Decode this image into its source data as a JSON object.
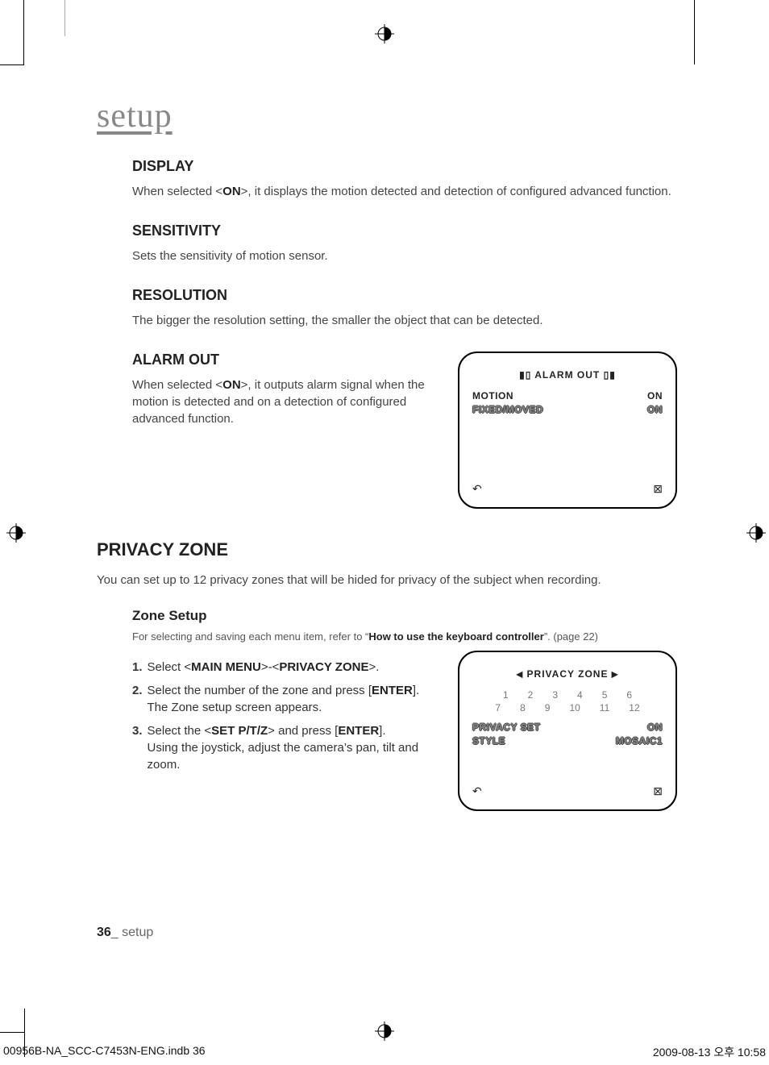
{
  "chapter_title": "setup",
  "sections": {
    "display": {
      "heading": "DISPLAY",
      "body_pre": "When selected <",
      "body_bold": "ON",
      "body_post": ">, it displays the motion detected and detection of configured advanced function."
    },
    "sensitivity": {
      "heading": "SENSITIVITY",
      "body": "Sets the sensitivity of motion sensor."
    },
    "resolution": {
      "heading": "RESOLUTION",
      "body": "The bigger the resolution setting, the smaller the object that can be detected."
    },
    "alarm_out": {
      "heading": "ALARM OUT",
      "body_pre": "When selected <",
      "body_bold": "ON",
      "body_post": ">, it outputs alarm signal when the motion is detected and on a detection of configured advanced function."
    }
  },
  "alarm_panel": {
    "title": "ALARM OUT",
    "bracket_l": "▮▯",
    "bracket_r": "▯▮",
    "rows": [
      {
        "label": "MOTION",
        "value": "ON"
      },
      {
        "label": "FIXED/MOVED",
        "value": "ON"
      }
    ],
    "back_icon": "↶",
    "close_icon": "⊠"
  },
  "privacy": {
    "heading": "PRIVACY ZONE",
    "intro": "You can set up to 12 privacy zones that will be hided for privacy of the subject when recording.",
    "zone_setup": {
      "heading": "Zone Setup",
      "ref_pre": "For selecting and saving each menu item, refer to “",
      "ref_bold": "How to use the keyboard controller",
      "ref_post": "”. (page 22)",
      "steps": [
        {
          "n": "1.",
          "parts": [
            "Select <",
            "MAIN MENU",
            ">-<",
            "PRIVACY ZONE",
            ">."
          ]
        },
        {
          "n": "2.",
          "parts": [
            "Select the number of the zone and press [",
            "ENTER",
            "].",
            "The Zone setup screen appears."
          ]
        },
        {
          "n": "3.",
          "parts": [
            "Select the <",
            "SET P/T/Z",
            "> and press [",
            "ENTER",
            "].",
            "Using the joystick, adjust the camera’s pan, tilt and zoom."
          ]
        }
      ]
    }
  },
  "privacy_panel": {
    "title": "PRIVACY ZONE",
    "arrow_l": "◀",
    "arrow_r": "▶",
    "row1": [
      "1",
      "2",
      "3",
      "4",
      "5",
      "6"
    ],
    "row2": [
      "7",
      "8",
      "9",
      "10",
      "11",
      "12"
    ],
    "settings": [
      {
        "label": "PRIVACY SET",
        "value": "ON"
      },
      {
        "label": "STYLE",
        "value": "MOSAIC1"
      }
    ],
    "back_icon": "↶",
    "close_icon": "⊠"
  },
  "footer": {
    "page_num": "36",
    "sep": "_ ",
    "chapter": "setup"
  },
  "slug": {
    "file": "00956B-NA_SCC-C7453N-ENG.indb   36",
    "date": "2009-08-13   오후 10:58"
  }
}
